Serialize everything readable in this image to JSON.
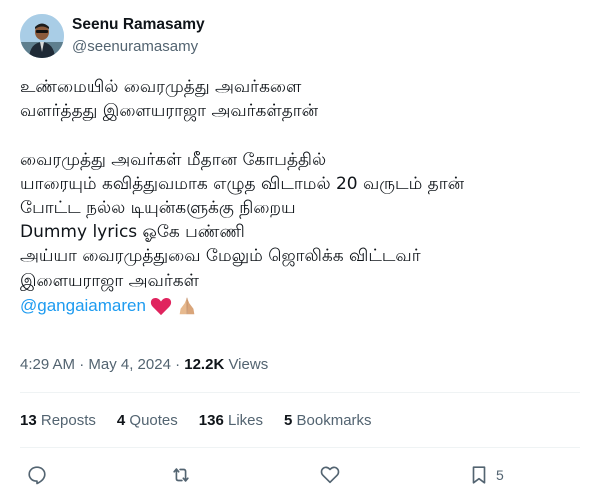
{
  "author": {
    "display_name": "Seenu Ramasamy",
    "handle": "@seenuramasamy"
  },
  "tweet": {
    "lines": [
      "உண்மையில் வைரமுத்து அவர்களை",
      "வளர்த்தது இளையராஜா அவர்கள்தான்",
      "",
      "வைரமுத்து அவர்கள் மீதான கோபத்தில்",
      "யாரையும் கவித்துவமாக எழுத விடாமல் 20 வருடம் தான்",
      "போட்ட நல்ல டியுன்களுக்கு நிறைய",
      "Dummy lyrics ஓகே பண்ணி",
      "அய்யா வைரமுத்துவை மேலும் ஜொலிக்க விட்டவர்",
      "இளையராஜா அவர்கள்"
    ],
    "mention": "@gangaiamaren"
  },
  "meta": {
    "timestamp": "4:29 AM · May 4, 2024 · ",
    "views_count": "12.2K",
    "views_label": " Views"
  },
  "stats": {
    "reposts_count": "13",
    "reposts_label": "Reposts",
    "quotes_count": "4",
    "quotes_label": "Quotes",
    "likes_count": "136",
    "likes_label": "Likes",
    "bookmarks_count": "5",
    "bookmarks_label": "Bookmarks"
  },
  "actions": {
    "bookmark_count": "5"
  },
  "icons": {
    "reply": "reply-icon",
    "repost": "repost-icon",
    "like": "heart-icon",
    "bookmark": "bookmark-icon",
    "emoji_heart": "red-heart-emoji",
    "emoji_pray": "folded-hands-emoji"
  },
  "colors": {
    "link": "#1d9bf0",
    "text": "#0f1419",
    "secondary": "#536471",
    "divider": "#eff3f4",
    "heart_emoji": "#e0245e",
    "pray_emoji": "#e7b98e"
  }
}
